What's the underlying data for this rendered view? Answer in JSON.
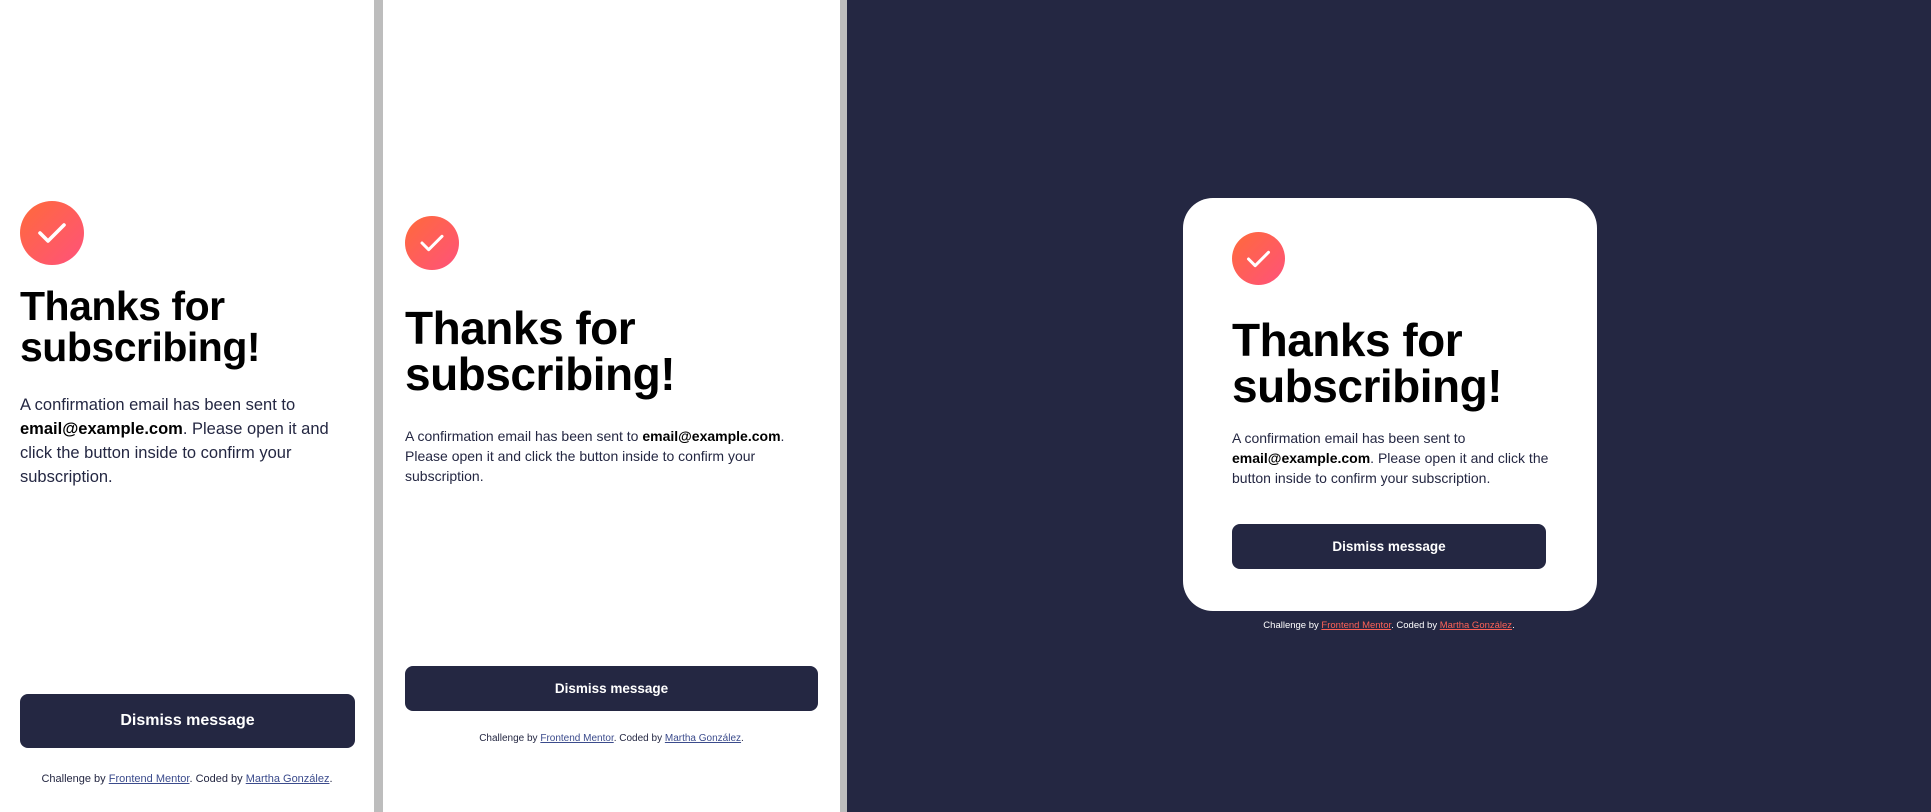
{
  "colors": {
    "accent_start": "#ff6a3a",
    "accent_end": "#ff527b",
    "dark_navy": "#242742",
    "link_light": "#3b4b8c",
    "link_on_dark": "#ff6257",
    "divider": "#bdbdbd"
  },
  "icons": {
    "success": "check-icon"
  },
  "success": {
    "title_line1": "Thanks for",
    "title_line2": "subscribing!",
    "body_prefix": "A confirmation email has been sent to ",
    "email": "email@example.com",
    "body_suffix": ". Please open it and click the button inside to confirm your subscription.",
    "dismiss_label": "Dismiss message"
  },
  "footer": {
    "prefix": "Challenge by ",
    "link1": "Frontend Mentor",
    "middle": ". Coded by ",
    "link2": "Martha González",
    "suffix": "."
  }
}
